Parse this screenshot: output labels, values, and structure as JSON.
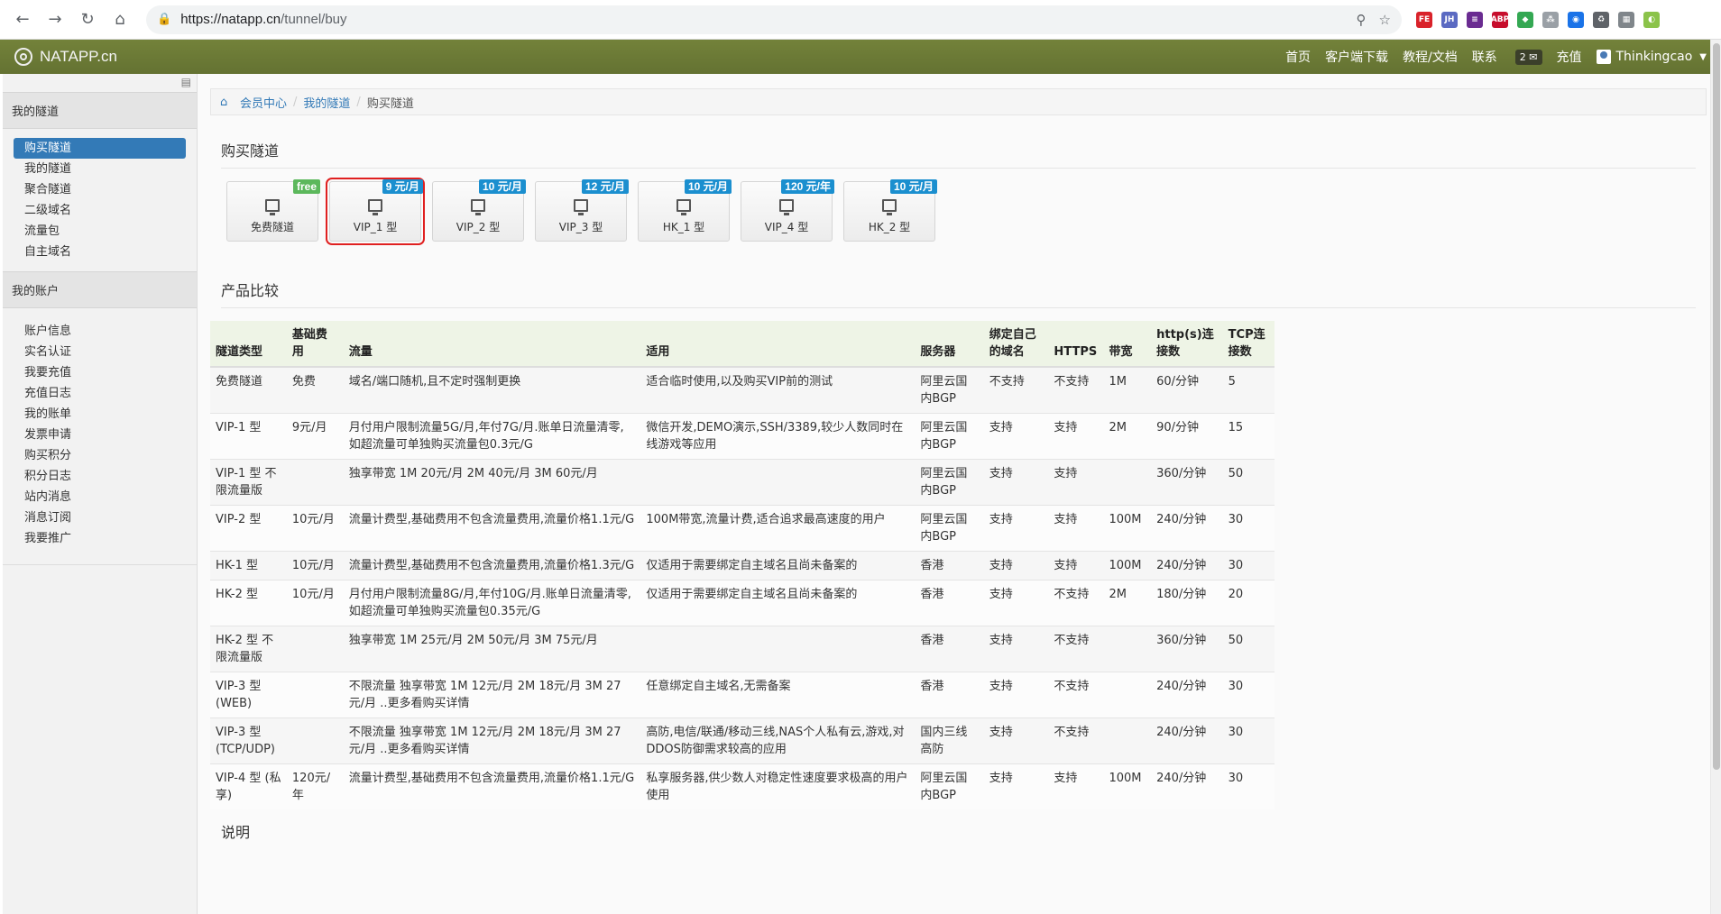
{
  "browser": {
    "url_host": "https://natapp.cn",
    "url_path": "/tunnel/buy",
    "extensions": [
      {
        "name": "fe-extension-icon",
        "label": "FE",
        "color": "#d9222a"
      },
      {
        "name": "jh-extension-icon",
        "label": "JH",
        "color": "#5b6ac2"
      },
      {
        "name": "purple-extension-icon",
        "label": "≡",
        "color": "#6a2c91"
      },
      {
        "name": "abp-extension-icon",
        "label": "ABP",
        "color": "#c70d2c"
      },
      {
        "name": "color-extension-icon",
        "label": "◆",
        "color": "#34a853"
      },
      {
        "name": "tree-extension-icon",
        "label": "⁂",
        "color": "#9aa0a6"
      },
      {
        "name": "blue-extension-icon",
        "label": "◉",
        "color": "#1a73e8"
      },
      {
        "name": "recycle-extension-icon",
        "label": "♻",
        "color": "#5f6368"
      },
      {
        "name": "store-extension-icon",
        "label": "▦",
        "color": "#80868b"
      },
      {
        "name": "profile-avatar-icon",
        "label": "◐",
        "color": "#8bc34a"
      }
    ]
  },
  "nav": {
    "brand": "NATAPP.cn",
    "links": [
      "首页",
      "客户端下载",
      "教程/文档",
      "联系"
    ],
    "msg_count": "2",
    "recharge": "充值",
    "username": "Thinkingcao"
  },
  "sidebar": {
    "tunnels_head": "我的隧道",
    "tunnel_items": [
      "购买隧道",
      "我的隧道",
      "聚合隧道",
      "二级域名",
      "流量包",
      "自主域名"
    ],
    "account_head": "我的账户",
    "account_items": [
      "账户信息",
      "实名认证",
      "我要充值",
      "充值日志",
      "我的账单",
      "发票申请",
      "购买积分",
      "积分日志",
      "站内消息",
      "消息订阅",
      "我要推广"
    ]
  },
  "breadcrumb": {
    "items": [
      "会员中心",
      "我的隧道"
    ],
    "current": "购买隧道"
  },
  "buy": {
    "title": "购买隧道",
    "products": [
      {
        "label": "免费隧道",
        "tag": "free",
        "tag_type": "free"
      },
      {
        "label": "VIP_1 型",
        "tag": "9 元/月",
        "tag_type": "price"
      },
      {
        "label": "VIP_2 型",
        "tag": "10 元/月",
        "tag_type": "price"
      },
      {
        "label": "VIP_3 型",
        "tag": "12 元/月",
        "tag_type": "price"
      },
      {
        "label": "HK_1 型",
        "tag": "10 元/月",
        "tag_type": "price"
      },
      {
        "label": "VIP_4 型",
        "tag": "120 元/年",
        "tag_type": "price"
      },
      {
        "label": "HK_2 型",
        "tag": "10 元/月",
        "tag_type": "price"
      }
    ]
  },
  "compare": {
    "title": "产品比较",
    "headers": [
      "隧道类型",
      "基础费用",
      "流量",
      "适用",
      "服务器",
      "绑定自己的域名",
      "HTTPS",
      "带宽",
      "http(s)连接数",
      "TCP连接数"
    ],
    "rows": [
      [
        "免费隧道",
        "免费",
        "域名/端口随机,且不定时强制更换",
        "适合临时使用,以及购买VIP前的测试",
        "阿里云国内BGP",
        "不支持",
        "不支持",
        "1M",
        "60/分钟",
        "5"
      ],
      [
        "VIP-1 型",
        "9元/月",
        "月付用户限制流量5G/月,年付7G/月.账单日流量清零,如超流量可单独购买流量包0.3元/G",
        "微信开发,DEMO演示,SSH/3389,较少人数同时在线游戏等应用",
        "阿里云国内BGP",
        "支持",
        "支持",
        "2M",
        "90/分钟",
        "15"
      ],
      [
        "VIP-1 型 不限流量版",
        "",
        "独享带宽 1M 20元/月 2M 40元/月 3M 60元/月",
        "",
        "阿里云国内BGP",
        "支持",
        "支持",
        "",
        "360/分钟",
        "50"
      ],
      [
        "VIP-2 型",
        "10元/月",
        "流量计费型,基础费用不包含流量费用,流量价格1.1元/G",
        "100M带宽,流量计费,适合追求最高速度的用户",
        "阿里云国内BGP",
        "支持",
        "支持",
        "100M",
        "240/分钟",
        "30"
      ],
      [
        "HK-1 型",
        "10元/月",
        "流量计费型,基础费用不包含流量费用,流量价格1.3元/G",
        "仅适用于需要绑定自主域名且尚未备案的",
        "香港",
        "支持",
        "支持",
        "100M",
        "240/分钟",
        "30"
      ],
      [
        "HK-2 型",
        "10元/月",
        "月付用户限制流量8G/月,年付10G/月.账单日流量清零,如超流量可单独购买流量包0.35元/G",
        "仅适用于需要绑定自主域名且尚未备案的",
        "香港",
        "支持",
        "不支持",
        "2M",
        "180/分钟",
        "20"
      ],
      [
        "HK-2 型 不限流量版",
        "",
        "独享带宽 1M 25元/月 2M 50元/月 3M 75元/月",
        "",
        "香港",
        "支持",
        "不支持",
        "",
        "360/分钟",
        "50"
      ],
      [
        "VIP-3 型 (WEB)",
        "",
        "不限流量 独享带宽 1M 12元/月 2M 18元/月 3M 27元/月 ..更多看购买详情",
        "任意绑定自主域名,无需备案",
        "香港",
        "支持",
        "不支持",
        "",
        "240/分钟",
        "30"
      ],
      [
        "VIP-3 型 (TCP/UDP)",
        "",
        "不限流量 独享带宽 1M 12元/月 2M 18元/月 3M 27元/月 ..更多看购买详情",
        "高防,电信/联通/移动三线,NAS个人私有云,游戏,对DDOS防御需求较高的应用",
        "国内三线高防",
        "支持",
        "不支持",
        "",
        "240/分钟",
        "30"
      ],
      [
        "VIP-4 型 (私享)",
        "120元/年",
        "流量计费型,基础费用不包含流量费用,流量价格1.1元/G",
        "私享服务器,供少数人对稳定性速度要求极高的用户使用",
        "阿里云国内BGP",
        "支持",
        "支持",
        "100M",
        "240/分钟",
        "30"
      ]
    ]
  },
  "note": {
    "title": "说明"
  }
}
